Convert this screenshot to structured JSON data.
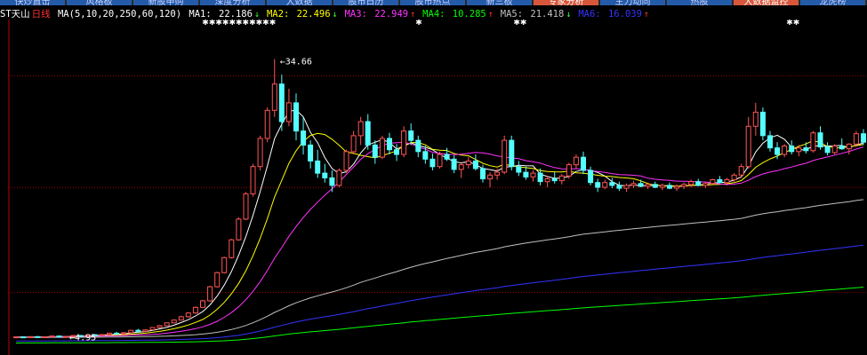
{
  "topbar": {
    "items": [
      {
        "label": "快炒直击",
        "highlight": false
      },
      {
        "label": "风格板",
        "highlight": false
      },
      {
        "label": "新股申购",
        "highlight": false
      },
      {
        "label": "深度分析",
        "highlight": false
      },
      {
        "label": "大数据",
        "highlight": false
      },
      {
        "label": "股市日历",
        "highlight": false
      },
      {
        "label": "股市热点",
        "highlight": false
      },
      {
        "label": "新三板",
        "highlight": false
      },
      {
        "label": "专家分析",
        "highlight": true
      },
      {
        "label": "主力动向",
        "highlight": false
      },
      {
        "label": "热股",
        "highlight": false
      },
      {
        "label": "大数据监控",
        "highlight": true
      },
      {
        "label": "龙虎榜",
        "highlight": false
      }
    ]
  },
  "legend": {
    "stock_name": "ST天山",
    "period": "日线",
    "ma_periods": "MA(5,10,20,250,60,120)",
    "ma": [
      {
        "label": "MA1:",
        "value": "22.186",
        "dir": "↓",
        "color": "#ffffff"
      },
      {
        "label": "MA2:",
        "value": "22.496",
        "dir": "↓",
        "color": "#ffff00"
      },
      {
        "label": "MA3:",
        "value": "22.949",
        "dir": "↑",
        "color": "#ff33ff"
      },
      {
        "label": "MA4:",
        "value": "10.285",
        "dir": "↑",
        "color": "#00ff00"
      },
      {
        "label": "MA5:",
        "value": "21.418",
        "dir": "↓",
        "color": "#c0c0c0"
      },
      {
        "label": "MA6:",
        "value": "16.039",
        "dir": "↑",
        "color": "#3333ff"
      }
    ]
  },
  "chart_data": {
    "type": "candlestick",
    "max_label": "34.66",
    "min_label": "4.95",
    "ylim": [
      3.5,
      38.5
    ],
    "colors": {
      "up": "#ff5555",
      "down": "#55ffff",
      "grid": "#a00000",
      "axis": "#c00000",
      "ma1": "#ffffff",
      "ma2": "#ffff00",
      "ma3": "#ff33ff",
      "ma4": "#00ff00",
      "ma5": "#c0c0c0",
      "ma6": "#3333ff"
    },
    "markers": [
      {
        "text": "✱✱✱✱✱✱✱✱✱✱✱",
        "index": 30
      },
      {
        "text": "✱",
        "index": 56
      },
      {
        "text": "✱✱",
        "index": 70
      },
      {
        "text": "✱✱",
        "index": 108
      }
    ],
    "candles": [
      [
        5.0,
        5.1,
        4.95,
        5.05
      ],
      [
        5.05,
        5.12,
        4.98,
        5.0
      ],
      [
        5.0,
        5.1,
        4.96,
        5.08
      ],
      [
        5.08,
        5.15,
        5.0,
        5.02
      ],
      [
        5.02,
        5.1,
        4.97,
        5.06
      ],
      [
        5.06,
        5.18,
        5.0,
        5.15
      ],
      [
        5.15,
        5.2,
        5.05,
        5.08
      ],
      [
        5.08,
        5.12,
        5.0,
        5.1
      ],
      [
        5.1,
        5.22,
        5.06,
        5.2
      ],
      [
        5.2,
        5.25,
        5.1,
        5.12
      ],
      [
        5.12,
        5.3,
        5.08,
        5.28
      ],
      [
        5.28,
        5.35,
        5.2,
        5.25
      ],
      [
        5.25,
        5.32,
        5.15,
        5.3
      ],
      [
        5.3,
        5.5,
        5.25,
        5.45
      ],
      [
        5.45,
        5.6,
        5.35,
        5.4
      ],
      [
        5.4,
        5.55,
        5.3,
        5.5
      ],
      [
        5.5,
        5.8,
        5.45,
        5.75
      ],
      [
        5.75,
        5.9,
        5.6,
        5.65
      ],
      [
        5.65,
        5.85,
        5.55,
        5.8
      ],
      [
        5.8,
        6.1,
        5.75,
        6.05
      ],
      [
        6.05,
        6.3,
        5.95,
        6.25
      ],
      [
        6.25,
        6.6,
        6.2,
        6.55
      ],
      [
        6.55,
        6.9,
        6.5,
        6.85
      ],
      [
        6.85,
        7.3,
        6.8,
        7.2
      ],
      [
        7.2,
        7.7,
        7.1,
        7.6
      ],
      [
        7.6,
        8.3,
        7.5,
        8.2
      ],
      [
        8.2,
        9.0,
        8.1,
        8.9
      ],
      [
        8.9,
        10.5,
        8.8,
        10.4
      ],
      [
        10.4,
        12.0,
        10.3,
        11.9
      ],
      [
        11.9,
        13.6,
        11.8,
        13.5
      ],
      [
        13.5,
        15.5,
        13.4,
        15.4
      ],
      [
        15.4,
        17.8,
        15.3,
        17.6
      ],
      [
        17.6,
        20.5,
        17.5,
        20.3
      ],
      [
        20.3,
        23.5,
        20.0,
        23.2
      ],
      [
        23.2,
        26.5,
        22.8,
        26.2
      ],
      [
        26.2,
        29.5,
        25.8,
        29.2
      ],
      [
        29.2,
        34.66,
        28.5,
        32.0
      ],
      [
        32.0,
        33.0,
        27.0,
        28.0
      ],
      [
        28.0,
        31.5,
        27.5,
        30.0
      ],
      [
        30.0,
        31.0,
        26.0,
        27.0
      ],
      [
        27.0,
        28.5,
        24.5,
        25.5
      ],
      [
        25.5,
        26.0,
        23.0,
        23.8
      ],
      [
        23.8,
        25.0,
        22.0,
        22.5
      ],
      [
        22.5,
        23.5,
        21.5,
        22.0
      ],
      [
        22.0,
        22.8,
        20.5,
        21.2
      ],
      [
        21.2,
        23.0,
        21.0,
        22.8
      ],
      [
        22.8,
        25.0,
        22.5,
        24.8
      ],
      [
        24.8,
        27.0,
        24.5,
        26.5
      ],
      [
        26.5,
        28.5,
        25.5,
        28.0
      ],
      [
        28.0,
        28.8,
        25.0,
        25.5
      ],
      [
        25.5,
        26.0,
        23.5,
        24.2
      ],
      [
        24.2,
        26.5,
        24.0,
        26.2
      ],
      [
        26.2,
        26.8,
        24.5,
        25.0
      ],
      [
        25.0,
        25.6,
        23.8,
        24.5
      ],
      [
        24.5,
        27.5,
        24.2,
        27.0
      ],
      [
        27.0,
        27.8,
        25.5,
        26.0
      ],
      [
        26.0,
        26.5,
        24.2,
        24.8
      ],
      [
        24.8,
        25.4,
        23.5,
        24.0
      ],
      [
        24.0,
        24.6,
        22.8,
        23.2
      ],
      [
        23.2,
        24.8,
        23.0,
        24.5
      ],
      [
        24.5,
        25.2,
        23.8,
        24.0
      ],
      [
        24.0,
        24.4,
        22.5,
        22.9
      ],
      [
        22.9,
        23.6,
        22.0,
        23.4
      ],
      [
        23.4,
        24.2,
        23.0,
        23.8
      ],
      [
        23.8,
        24.5,
        22.8,
        23.0
      ],
      [
        23.0,
        23.4,
        21.5,
        21.9
      ],
      [
        21.9,
        22.6,
        21.0,
        22.3
      ],
      [
        22.3,
        23.0,
        21.8,
        22.6
      ],
      [
        22.6,
        26.5,
        22.4,
        26.0
      ],
      [
        26.0,
        26.5,
        22.8,
        23.2
      ],
      [
        23.2,
        23.8,
        22.2,
        22.6
      ],
      [
        22.6,
        23.2,
        21.8,
        22.1
      ],
      [
        22.1,
        22.8,
        21.6,
        22.5
      ],
      [
        22.5,
        23.0,
        21.2,
        21.6
      ],
      [
        21.6,
        22.2,
        21.0,
        21.9
      ],
      [
        21.9,
        22.6,
        21.4,
        21.7
      ],
      [
        21.7,
        22.4,
        21.3,
        22.2
      ],
      [
        22.2,
        23.6,
        21.9,
        23.4
      ],
      [
        23.4,
        24.5,
        23.0,
        24.2
      ],
      [
        24.2,
        24.8,
        22.4,
        22.8
      ],
      [
        22.8,
        23.2,
        21.2,
        21.5
      ],
      [
        21.5,
        21.9,
        20.5,
        21.0
      ],
      [
        21.0,
        21.8,
        20.8,
        21.5
      ],
      [
        21.5,
        22.0,
        20.9,
        21.2
      ],
      [
        21.2,
        21.6,
        20.6,
        20.9
      ],
      [
        20.9,
        21.4,
        20.5,
        21.2
      ],
      [
        21.2,
        21.7,
        20.9,
        21.4
      ],
      [
        21.4,
        21.8,
        21.0,
        21.1
      ],
      [
        21.1,
        21.5,
        20.8,
        21.3
      ],
      [
        21.3,
        21.6,
        20.9,
        21.0
      ],
      [
        21.0,
        21.4,
        20.7,
        21.2
      ],
      [
        21.2,
        21.5,
        20.8,
        20.9
      ],
      [
        20.9,
        21.3,
        20.6,
        21.1
      ],
      [
        21.1,
        21.5,
        20.8,
        21.3
      ],
      [
        21.3,
        21.8,
        21.0,
        21.6
      ],
      [
        21.6,
        21.9,
        21.1,
        21.2
      ],
      [
        21.2,
        21.6,
        20.9,
        21.4
      ],
      [
        21.4,
        21.9,
        21.2,
        21.8
      ],
      [
        21.8,
        22.2,
        21.4,
        21.5
      ],
      [
        21.5,
        22.0,
        21.2,
        21.8
      ],
      [
        21.8,
        22.5,
        21.6,
        22.3
      ],
      [
        22.3,
        23.5,
        22.0,
        23.2
      ],
      [
        23.2,
        28.5,
        23.0,
        27.5
      ],
      [
        27.5,
        30.0,
        26.5,
        29.0
      ],
      [
        29.0,
        29.5,
        26.0,
        26.5
      ],
      [
        26.5,
        27.0,
        24.8,
        25.2
      ],
      [
        25.2,
        25.8,
        24.0,
        24.5
      ],
      [
        24.5,
        25.6,
        24.2,
        25.4
      ],
      [
        25.4,
        26.0,
        24.5,
        24.8
      ],
      [
        24.8,
        25.5,
        24.3,
        25.2
      ],
      [
        25.2,
        25.8,
        24.6,
        24.9
      ],
      [
        24.9,
        27.0,
        24.7,
        26.8
      ],
      [
        26.8,
        27.5,
        25.0,
        25.3
      ],
      [
        25.3,
        25.8,
        24.4,
        24.7
      ],
      [
        24.7,
        25.6,
        24.5,
        25.4
      ],
      [
        25.4,
        26.2,
        25.0,
        25.1
      ],
      [
        25.1,
        25.7,
        24.5,
        25.6
      ],
      [
        25.6,
        27.0,
        25.3,
        26.7
      ],
      [
        26.7,
        27.2,
        25.5,
        25.8
      ]
    ]
  }
}
